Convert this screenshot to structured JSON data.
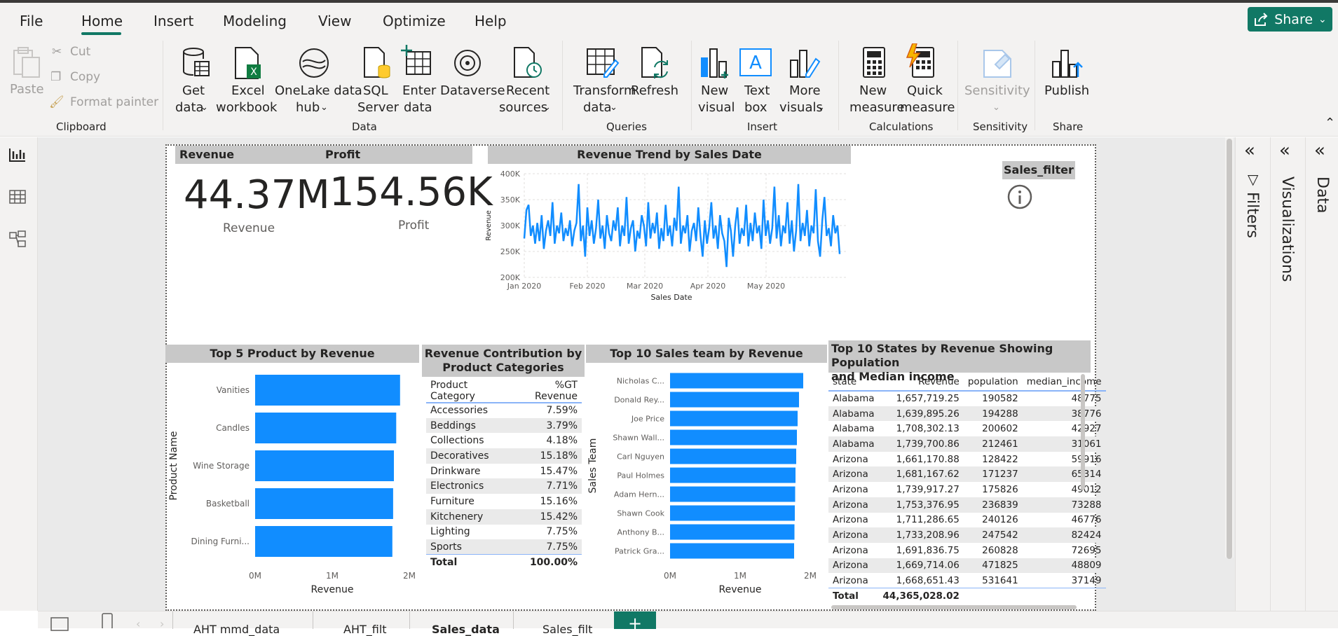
{
  "menu": {
    "file": "File",
    "home": "Home",
    "insert": "Insert",
    "modeling": "Modeling",
    "view": "View",
    "optimize": "Optimize",
    "help": "Help",
    "share": "Share"
  },
  "ribbon": {
    "paste": "Paste",
    "cut": "Cut",
    "copy": "Copy",
    "format_painter": "Format painter",
    "get_data_1": "Get",
    "get_data_2": "data",
    "excel_1": "Excel",
    "excel_2": "workbook",
    "onelake_1": "OneLake data",
    "onelake_2": "hub",
    "sql_1": "SQL",
    "sql_2": "Server",
    "enter_1": "Enter",
    "enter_2": "data",
    "dataverse": "Dataverse",
    "recent_1": "Recent",
    "recent_2": "sources",
    "transform_1": "Transform",
    "transform_2": "data",
    "refresh": "Refresh",
    "new_visual_1": "New",
    "new_visual_2": "visual",
    "text_box_1": "Text",
    "text_box_2": "box",
    "more_visuals_1": "More",
    "more_visuals_2": "visuals",
    "new_measure_1": "New",
    "new_measure_2": "measure",
    "quick_measure_1": "Quick",
    "quick_measure_2": "measure",
    "sensitivity": "Sensitivity",
    "publish": "Publish",
    "groups": {
      "clipboard": "Clipboard",
      "data": "Data",
      "queries": "Queries",
      "insert": "Insert",
      "calculations": "Calculations",
      "sensitivity": "Sensitivity",
      "share": "Share"
    }
  },
  "cards": {
    "revenue_header": "Revenue",
    "profit_header": "Profit",
    "revenue_value": "44.37M",
    "revenue_label": "Revenue",
    "profit_value": "154.56K",
    "profit_label": "Profit"
  },
  "slicer": {
    "title": "Sales_filter"
  },
  "titles": {
    "trend": "Revenue Trend by Sales Date",
    "top5": "Top 5 Product by Revenue",
    "contrib_1": "Revenue Contribution by",
    "contrib_2": "Product Categories",
    "top10team": "Top 10 Sales team by Revenue",
    "states_1": "Top 10 States by Revenue Showing Population",
    "states_2": "and Median income"
  },
  "chart_data": [
    {
      "type": "line",
      "title": "Revenue Trend by Sales Date",
      "xlabel": "Sales Date",
      "ylabel": "Revenue",
      "ylim": [
        200000,
        400000
      ],
      "yticks": [
        "200K",
        "250K",
        "300K",
        "350K",
        "400K"
      ],
      "xticks": [
        "Jan 2020",
        "Feb 2020",
        "Mar 2020",
        "Apr 2020",
        "May 2020"
      ],
      "grid": true,
      "values": [
        275000,
        330000,
        340000,
        280000,
        300000,
        265000,
        305000,
        270000,
        320000,
        255000,
        290000,
        310000,
        280000,
        345000,
        265000,
        300000,
        285000,
        325000,
        270000,
        295000,
        280000,
        310000,
        260000,
        290000,
        305000,
        380000,
        270000,
        300000,
        240000,
        335000,
        280000,
        310000,
        265000,
        295000,
        350000,
        275000,
        300000,
        255000,
        320000,
        285000,
        270000,
        310000,
        290000,
        335000,
        260000,
        300000,
        280000,
        355000,
        265000,
        295000,
        310000,
        250000,
        290000,
        275000,
        320000,
        300000,
        260000,
        345000,
        275000,
        305000,
        285000,
        325000,
        255000,
        295000,
        270000,
        340000,
        280000,
        300000,
        260000,
        315000,
        290000,
        375000,
        265000,
        300000,
        285000,
        320000,
        250000,
        290000,
        305000,
        270000,
        335000,
        280000,
        240000,
        310000,
        265000,
        295000,
        345000,
        275000,
        300000,
        255000,
        320000,
        285000,
        270000,
        220000,
        315000,
        290000,
        240000,
        300000,
        335000,
        265000,
        295000,
        280000,
        340000,
        260000,
        305000,
        270000,
        325000,
        285000,
        300000,
        255000,
        350000,
        280000,
        310000,
        265000,
        295000,
        375000,
        275000,
        320000,
        260000,
        300000,
        285000,
        345000,
        265000,
        310000,
        250000,
        290000,
        380000,
        270000,
        305000,
        280000,
        330000,
        260000,
        300000,
        285000,
        370000,
        270000,
        240000,
        310000,
        355000,
        280000,
        295000,
        260000,
        320000,
        285000,
        300000,
        245000
      ]
    },
    {
      "type": "bar",
      "title": "Top 5 Product by Revenue",
      "xlabel": "Revenue",
      "ylabel": "Product Name",
      "xticks": [
        "0M",
        "1M",
        "2M"
      ],
      "xlim": [
        0,
        2000000
      ],
      "categories": [
        "Vanities",
        "Candles",
        "Wine Storage",
        "Basketball",
        "Dining Furni..."
      ],
      "values": [
        1880000,
        1830000,
        1800000,
        1790000,
        1780000
      ]
    },
    {
      "type": "bar",
      "title": "Top 10 Sales team by Revenue",
      "xlabel": "Revenue",
      "ylabel": "Sales Team",
      "xticks": [
        "0M",
        "1M",
        "2M"
      ],
      "xlim": [
        0,
        2000000
      ],
      "categories": [
        "Nicholas C...",
        "Donald Rey...",
        "Joe Price",
        "Shawn Wall...",
        "Carl Nguyen",
        "Paul Holmes",
        "Adam Hern...",
        "Shawn Cook",
        "Anthony B...",
        "Patrick Gra..."
      ],
      "values": [
        1900000,
        1840000,
        1820000,
        1810000,
        1800000,
        1790000,
        1785000,
        1780000,
        1775000,
        1770000
      ]
    },
    {
      "type": "table",
      "title": "Revenue Contribution by Product Categories",
      "columns": [
        "Product Category",
        "%GT Revenue"
      ],
      "rows": [
        [
          "Accessories",
          "7.59%"
        ],
        [
          "Beddings",
          "3.79%"
        ],
        [
          "Collections",
          "4.18%"
        ],
        [
          "Decoratives",
          "15.18%"
        ],
        [
          "Drinkware",
          "15.47%"
        ],
        [
          "Electronics",
          "7.71%"
        ],
        [
          "Furniture",
          "15.16%"
        ],
        [
          "Kitchenery",
          "15.42%"
        ],
        [
          "Lighting",
          "7.75%"
        ],
        [
          "Sports",
          "7.75%"
        ]
      ],
      "total": [
        "Total",
        "100.00%"
      ]
    },
    {
      "type": "table",
      "title": "Top 10 States by Revenue Showing Population and Median income",
      "columns": [
        "state",
        "Revenue",
        "population",
        "median_income"
      ],
      "rows": [
        [
          "Alabama",
          "1,657,719.25",
          "190582",
          "48775"
        ],
        [
          "Alabama",
          "1,639,895.26",
          "194288",
          "38776"
        ],
        [
          "Alabama",
          "1,708,302.13",
          "200602",
          "42927"
        ],
        [
          "Alabama",
          "1,739,700.86",
          "212461",
          "31061"
        ],
        [
          "Arizona",
          "1,661,170.88",
          "128422",
          "59916"
        ],
        [
          "Arizona",
          "1,681,167.62",
          "171237",
          "65314"
        ],
        [
          "Arizona",
          "1,739,917.27",
          "175826",
          "49012"
        ],
        [
          "Arizona",
          "1,753,376.95",
          "236839",
          "73288"
        ],
        [
          "Arizona",
          "1,711,286.65",
          "240126",
          "46776"
        ],
        [
          "Arizona",
          "1,733,208.96",
          "247542",
          "82424"
        ],
        [
          "Arizona",
          "1,691,836.75",
          "260828",
          "72695"
        ],
        [
          "Arizona",
          "1,669,714.06",
          "471825",
          "48809"
        ],
        [
          "Arizona",
          "1,668,651.43",
          "531641",
          "37149"
        ]
      ],
      "total": [
        "Total",
        "44,365,028.02",
        "",
        ""
      ]
    }
  ],
  "panes": {
    "filters": "Filters",
    "visualizations": "Visualizations",
    "data": "Data"
  },
  "page_tabs": [
    "AHT mmd_data",
    "AHT_filt",
    "Sales_data",
    "Sales_filt"
  ],
  "colors": {
    "bar": "#118dff",
    "accent": "#117865"
  }
}
